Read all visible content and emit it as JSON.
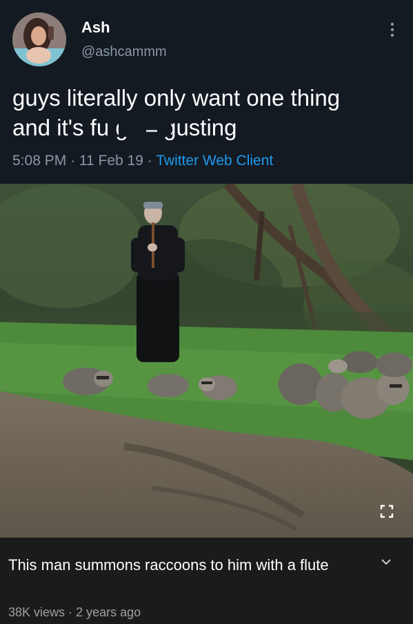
{
  "tweet": {
    "display_name": "Ash",
    "handle": "@ashcammm",
    "text": "guys literally only want one thing\nand it's fu      g disgusting",
    "time": "5:08 PM",
    "date": "11 Feb 19",
    "separator": "·",
    "source": "Twitter Web Client",
    "more_icon": "vertical-ellipsis-icon"
  },
  "video": {
    "title": "This man summons raccoons to him with a flute",
    "views": "38K views",
    "age": "2 years ago",
    "separator": "·",
    "fullscreen_icon": "fullscreen-icon",
    "expand_icon": "chevron-down-icon"
  },
  "colors": {
    "tweet_background": "#131a22",
    "secondary_text": "#8b98a5",
    "link": "#1d9bf0",
    "caption_background": "#1b1b1b"
  }
}
